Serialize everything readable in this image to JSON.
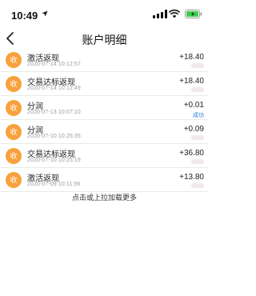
{
  "status_bar": {
    "time": "10:49"
  },
  "nav": {
    "title": "账户明细"
  },
  "records": [
    {
      "badge": "收",
      "name": "激活返现",
      "date": "2020-07-14 10:12:57",
      "amount": "+18.40",
      "note": ""
    },
    {
      "badge": "收",
      "name": "交易达标返现",
      "date": "2020-07-14 10:12:49",
      "amount": "+18.40",
      "note": ""
    },
    {
      "badge": "收",
      "name": "分润",
      "date": "2020-07-13 10:07:10",
      "amount": "+0.01",
      "note": "成功"
    },
    {
      "badge": "收",
      "name": "分润",
      "date": "2020-07-10 10:25:35",
      "amount": "+0.09",
      "note": ""
    },
    {
      "badge": "收",
      "name": "交易达标返现",
      "date": "2020-07-10 10:25:19",
      "amount": "+36.80",
      "note": ""
    },
    {
      "badge": "收",
      "name": "激活返现",
      "date": "2020-07-09 10:11:56",
      "amount": "+13.80",
      "note": ""
    }
  ],
  "footer": {
    "load_more": "点击或上拉加载更多"
  },
  "colors": {
    "badge": "#f6a23e",
    "note": "#2f7bd6"
  },
  "icons": [
    "location-arrow-icon",
    "signal-icon",
    "wifi-icon",
    "battery-icon",
    "back-chevron-icon"
  ]
}
